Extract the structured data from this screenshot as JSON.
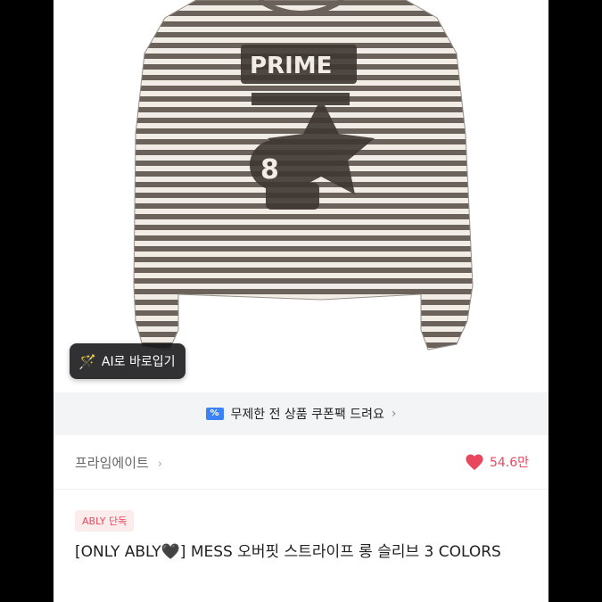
{
  "ai_button": {
    "label": "AI로 바로입기",
    "icon": "magic-wand-icon"
  },
  "coupon": {
    "text": "무제한 전 상품 쿠폰팩 드려요",
    "icon": "coupon-icon",
    "chevron": "›"
  },
  "brand": {
    "name": "프라임에이트",
    "chevron": "›"
  },
  "likes": {
    "count": "54.6만",
    "icon": "heart-icon",
    "color": "#e8475e"
  },
  "badge": {
    "label": "ABLY 단독"
  },
  "product": {
    "title": "[ONLY ABLY🖤] MESS 오버핏 스트라이프 롱 슬리브 3 COLORS"
  }
}
